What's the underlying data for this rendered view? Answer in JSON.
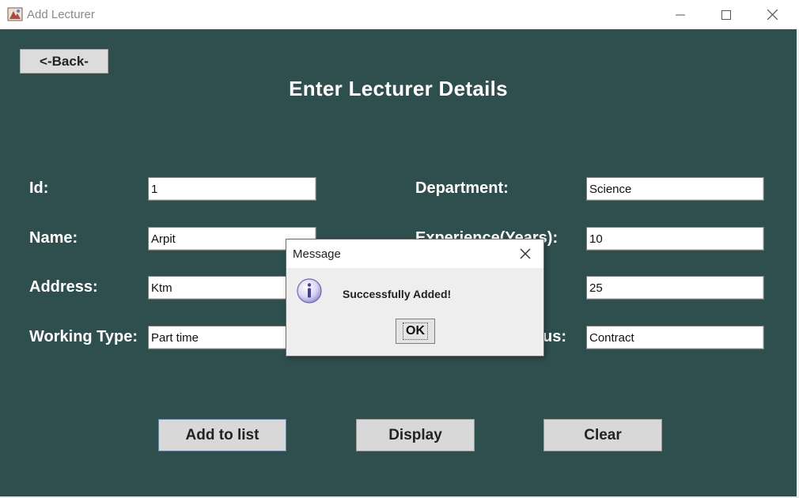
{
  "window": {
    "title": "Add Lecturer",
    "icon": "java-app-icon",
    "controls": [
      "minimize-icon",
      "maximize-icon",
      "close-icon"
    ]
  },
  "form": {
    "back_label": "<-Back-",
    "heading": "Enter Lecturer Details",
    "fields": {
      "id": {
        "label": "Id:",
        "value": "1"
      },
      "name": {
        "label": "Name:",
        "value": "Arpit"
      },
      "address": {
        "label": "Address:",
        "value": "Ktm"
      },
      "working_type": {
        "label": "Working Type:",
        "value": "Part time"
      },
      "department": {
        "label": "Department:",
        "value": "Science"
      },
      "experience": {
        "label": "Experience(Years):",
        "value": "10"
      },
      "field7": {
        "value": "25"
      },
      "status": {
        "label_partial": "us:",
        "value": "Contract"
      }
    },
    "buttons": {
      "add": "Add to list",
      "display": "Display",
      "clear": "Clear"
    }
  },
  "dialog": {
    "title": "Message",
    "message": "Successfully Added!",
    "ok_label": "OK",
    "icon": "info-icon"
  },
  "colors": {
    "panel_background": "#2f4f4f",
    "button_background": "#d8d8d8",
    "dialog_background": "#eeeeee"
  }
}
